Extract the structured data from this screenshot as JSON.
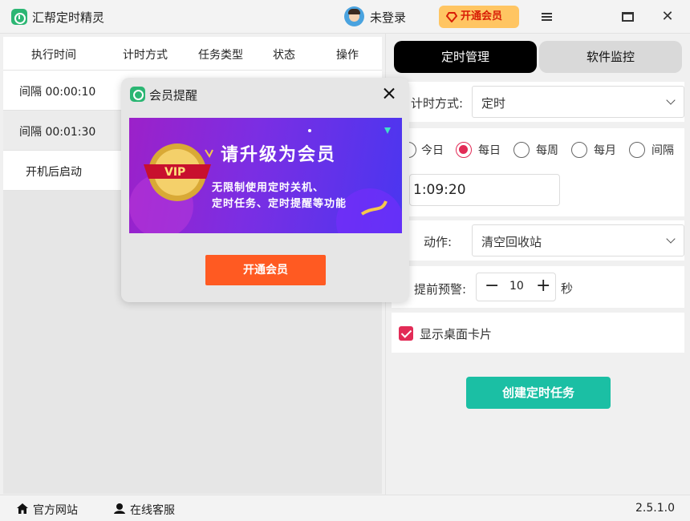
{
  "app": {
    "title": "汇帮定时精灵",
    "login_text": "未登录",
    "vip_button": "开通会员"
  },
  "table": {
    "headers": [
      "执行时间",
      "计时方式",
      "任务类型",
      "状态",
      "操作"
    ],
    "rows": [
      {
        "time": "间隔 00:00:10"
      },
      {
        "time": "间隔 00:01:30"
      },
      {
        "time": "开机后启动"
      }
    ]
  },
  "tabs": [
    "定时管理",
    "软件监控"
  ],
  "form": {
    "timing_label": "计时方式:",
    "timing_value": "定时",
    "frequency_options": [
      "今日",
      "每日",
      "每周",
      "每月",
      "间隔"
    ],
    "frequency_selected": "每日",
    "time_value": "1:09:20",
    "action_label": "动作:",
    "action_value": "清空回收站",
    "warning_label": "提前预警:",
    "warning_value": "10",
    "warning_unit": "秒",
    "show_card_label": "显示桌面卡片",
    "show_card_checked": true,
    "create_button": "创建定时任务"
  },
  "status": {
    "website": "官方网站",
    "support": "在线客服",
    "version": "2.5.1.0"
  },
  "modal": {
    "title": "会员提醒",
    "banner_heading": "请升级为会员",
    "banner_line1": "无限制使用定时关机、",
    "banner_line2": "定时任务、定时提醒等功能",
    "badge_text": "VIP",
    "open_button": "开通会员"
  },
  "colors": {
    "accent_red": "#e22b56",
    "create_button": "#1bbfa4",
    "modal_button": "#ff5a22",
    "vip_button_bg": "#ffc562"
  }
}
